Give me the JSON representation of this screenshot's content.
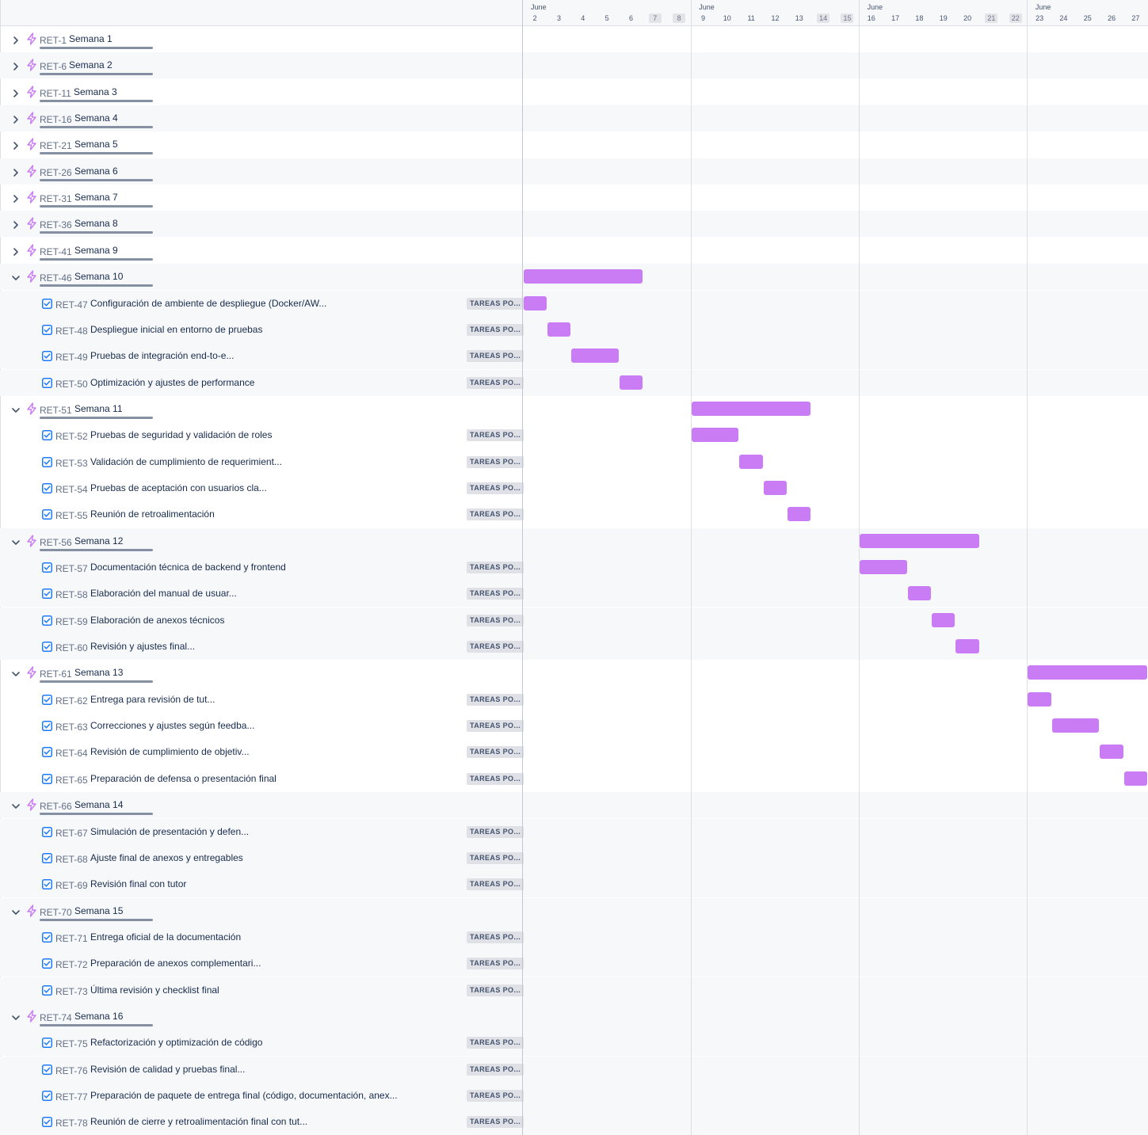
{
  "colors": {
    "bar": "#c97cf4",
    "epic_icon": "#c97cf4",
    "task_icon": "#1d7afc",
    "status_bg": "#dfe1e6"
  },
  "timeline": {
    "months": [
      "June",
      "June",
      "June",
      "June"
    ],
    "days": [
      "2",
      "3",
      "4",
      "5",
      "6",
      "7",
      "8",
      "9",
      "10",
      "11",
      "12",
      "13",
      "14",
      "15",
      "16",
      "17",
      "18",
      "19",
      "20",
      "21",
      "22",
      "23",
      "24",
      "25",
      "26",
      "27"
    ],
    "weekend_days": [
      "7",
      "8",
      "14",
      "15",
      "21",
      "22"
    ]
  },
  "rows": [
    {
      "type": "epic",
      "key": "RET-1",
      "summary": "Semana 1",
      "expanded": false
    },
    {
      "type": "epic",
      "key": "RET-6",
      "summary": "Semana 2",
      "expanded": false
    },
    {
      "type": "epic",
      "key": "RET-11",
      "summary": "Semana 3",
      "expanded": false
    },
    {
      "type": "epic",
      "key": "RET-16",
      "summary": "Semana 4",
      "expanded": false
    },
    {
      "type": "epic",
      "key": "RET-21",
      "summary": "Semana 5",
      "expanded": false
    },
    {
      "type": "epic",
      "key": "RET-26",
      "summary": "Semana 6",
      "expanded": false
    },
    {
      "type": "epic",
      "key": "RET-31",
      "summary": "Semana 7",
      "expanded": false
    },
    {
      "type": "epic",
      "key": "RET-36",
      "summary": "Semana 8",
      "expanded": false
    },
    {
      "type": "epic",
      "key": "RET-41",
      "summary": "Semana 9",
      "expanded": false
    },
    {
      "type": "epic",
      "key": "RET-46",
      "summary": "Semana 10",
      "expanded": true,
      "start": "2",
      "end": "6"
    },
    {
      "type": "task",
      "key": "RET-47",
      "summary": "Configuración de ambiente de despliegue (Docker/AW...",
      "status": "TAREAS PO...",
      "start": "2",
      "end": "2"
    },
    {
      "type": "task",
      "key": "RET-48",
      "summary": "Despliegue inicial en entorno de pruebas",
      "status": "TAREAS PO...",
      "start": "3",
      "end": "3"
    },
    {
      "type": "task",
      "key": "RET-49",
      "summary": "Pruebas de integración end-to-e...",
      "status": "TAREAS PO...",
      "start": "4",
      "end": "5"
    },
    {
      "type": "task",
      "key": "RET-50",
      "summary": "Optimización y ajustes de performance",
      "status": "TAREAS PO...",
      "start": "6",
      "end": "6"
    },
    {
      "type": "epic",
      "key": "RET-51",
      "summary": "Semana 11",
      "expanded": true,
      "start": "9",
      "end": "13"
    },
    {
      "type": "task",
      "key": "RET-52",
      "summary": "Pruebas de seguridad y validación de roles",
      "status": "TAREAS PO...",
      "start": "9",
      "end": "10"
    },
    {
      "type": "task",
      "key": "RET-53",
      "summary": "Validación de cumplimiento de requerimient...",
      "status": "TAREAS PO...",
      "start": "11",
      "end": "11"
    },
    {
      "type": "task",
      "key": "RET-54",
      "summary": "Pruebas de aceptación con usuarios cla...",
      "status": "TAREAS PO...",
      "start": "12",
      "end": "12"
    },
    {
      "type": "task",
      "key": "RET-55",
      "summary": "Reunión de retroalimentación",
      "status": "TAREAS PO...",
      "start": "13",
      "end": "13"
    },
    {
      "type": "epic",
      "key": "RET-56",
      "summary": "Semana 12",
      "expanded": true,
      "start": "16",
      "end": "20"
    },
    {
      "type": "task",
      "key": "RET-57",
      "summary": "Documentación técnica de backend y frontend",
      "status": "TAREAS PO...",
      "start": "16",
      "end": "17"
    },
    {
      "type": "task",
      "key": "RET-58",
      "summary": "Elaboración del manual de usuar...",
      "status": "TAREAS PO...",
      "start": "18",
      "end": "18"
    },
    {
      "type": "task",
      "key": "RET-59",
      "summary": "Elaboración de anexos técnicos",
      "status": "TAREAS PO...",
      "start": "19",
      "end": "19"
    },
    {
      "type": "task",
      "key": "RET-60",
      "summary": "Revisión y ajustes final...",
      "status": "TAREAS PO...",
      "start": "20",
      "end": "20"
    },
    {
      "type": "epic",
      "key": "RET-61",
      "summary": "Semana 13",
      "expanded": true,
      "start": "23",
      "end": "27"
    },
    {
      "type": "task",
      "key": "RET-62",
      "summary": "Entrega para revisión de tut...",
      "status": "TAREAS PO...",
      "start": "23",
      "end": "23"
    },
    {
      "type": "task",
      "key": "RET-63",
      "summary": "Correcciones y ajustes según feedba...",
      "status": "TAREAS PO...",
      "start": "24",
      "end": "25"
    },
    {
      "type": "task",
      "key": "RET-64",
      "summary": "Revisión de cumplimiento de objetiv...",
      "status": "TAREAS PO...",
      "start": "26",
      "end": "26"
    },
    {
      "type": "task",
      "key": "RET-65",
      "summary": "Preparación de defensa o presentación final",
      "status": "TAREAS PO...",
      "start": "27",
      "end": "27"
    },
    {
      "type": "epic",
      "key": "RET-66",
      "summary": "Semana 14",
      "expanded": true
    },
    {
      "type": "task",
      "key": "RET-67",
      "summary": "Simulación de presentación y defen...",
      "status": "TAREAS PO..."
    },
    {
      "type": "task",
      "key": "RET-68",
      "summary": "Ajuste final de anexos y entregables",
      "status": "TAREAS PO..."
    },
    {
      "type": "task",
      "key": "RET-69",
      "summary": "Revisión final con tutor",
      "status": "TAREAS PO..."
    },
    {
      "type": "epic",
      "key": "RET-70",
      "summary": "Semana 15",
      "expanded": true
    },
    {
      "type": "task",
      "key": "RET-71",
      "summary": "Entrega oficial de la documentación",
      "status": "TAREAS PO..."
    },
    {
      "type": "task",
      "key": "RET-72",
      "summary": "Preparación de anexos complementari...",
      "status": "TAREAS PO..."
    },
    {
      "type": "task",
      "key": "RET-73",
      "summary": "Última revisión y checklist final",
      "status": "TAREAS PO..."
    },
    {
      "type": "epic",
      "key": "RET-74",
      "summary": "Semana 16",
      "expanded": true
    },
    {
      "type": "task",
      "key": "RET-75",
      "summary": "Refactorización y optimización de código",
      "status": "TAREAS PO..."
    },
    {
      "type": "task",
      "key": "RET-76",
      "summary": "Revisión de calidad y pruebas final...",
      "status": "TAREAS PO..."
    },
    {
      "type": "task",
      "key": "RET-77",
      "summary": "Preparación de paquete de entrega final (código, documentación, anex...",
      "status": "TAREAS PO..."
    },
    {
      "type": "task",
      "key": "RET-78",
      "summary": "Reunión de cierre y retroalimentación final con tut...",
      "status": "TAREAS PO..."
    }
  ]
}
